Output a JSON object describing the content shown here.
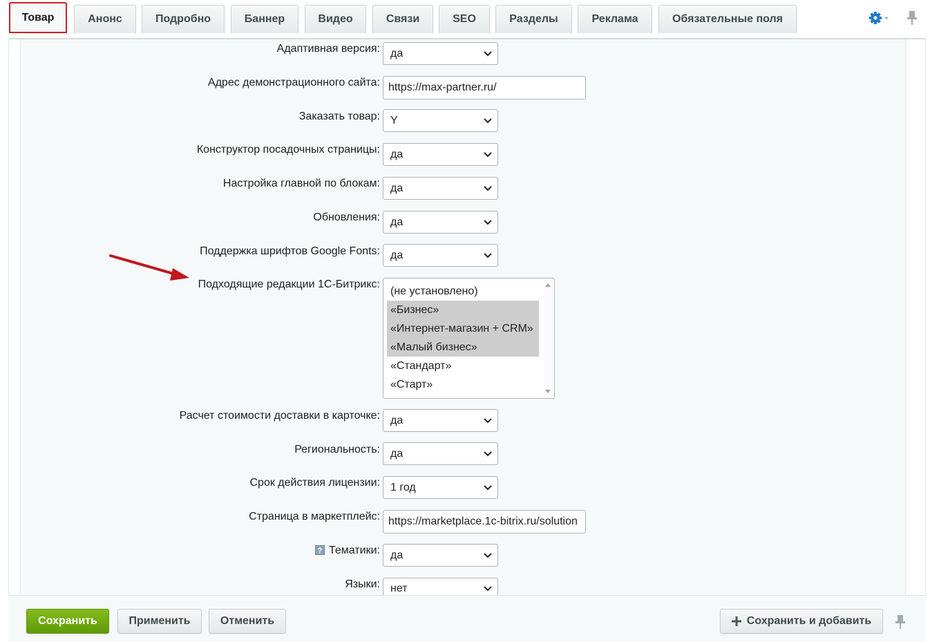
{
  "tabs": [
    {
      "label": "Товар",
      "active": true
    },
    {
      "label": "Анонс"
    },
    {
      "label": "Подробно"
    },
    {
      "label": "Баннер"
    },
    {
      "label": "Видео"
    },
    {
      "label": "Связи"
    },
    {
      "label": "SEO"
    },
    {
      "label": "Разделы"
    },
    {
      "label": "Реклама"
    },
    {
      "label": "Обязательные поля"
    }
  ],
  "header_icons": {
    "settings": "gear-icon",
    "pin": "pin-icon",
    "accent": "#1f7ac8"
  },
  "fields": {
    "adaptive": {
      "label": "Адаптивная версия:",
      "value": "да"
    },
    "demo_site": {
      "label": "Адрес демонстрационного сайта:",
      "value": "https://max-partner.ru/"
    },
    "order": {
      "label": "Заказать товар:",
      "value": "Y"
    },
    "landing": {
      "label": "Конструктор посадочных страницы:",
      "value": "да"
    },
    "main_blocks": {
      "label": "Настройка главной по блокам:",
      "value": "да"
    },
    "updates": {
      "label": "Обновления:",
      "value": "да"
    },
    "google_fonts": {
      "label": "Поддержка шрифтов Google Fonts:",
      "value": "да"
    },
    "editions": {
      "label": "Подходящие редакции 1С-Битрикс:",
      "options": [
        "(не установлено)",
        "«Бизнес»",
        "«Интернет-магазин + CRM»",
        "«Малый бизнес»",
        "«Стандарт»",
        "«Старт»"
      ],
      "selected": [
        "«Бизнес»",
        "«Интернет-магазин + CRM»",
        "«Малый бизнес»"
      ]
    },
    "delivery": {
      "label": "Расчет стоимости доставки в карточке:",
      "value": "да"
    },
    "regional": {
      "label": "Региональность:",
      "value": "да"
    },
    "license": {
      "label": "Срок действия лицензии:",
      "value": "1 год"
    },
    "marketplace": {
      "label": "Страница в маркетплейс:",
      "value": "https://marketplace.1c-bitrix.ru/solution"
    },
    "themes": {
      "label": "Тематики:",
      "value": "да"
    },
    "languages": {
      "label": "Языки:",
      "value": "нет"
    }
  },
  "annotation": {
    "arrow_color": "#c0171d",
    "highlight_color": "#c9202a"
  },
  "footer": {
    "save": "Сохранить",
    "apply": "Применить",
    "cancel": "Отменить",
    "save_add": "Сохранить и добавить",
    "save_color": "#6aa510"
  }
}
